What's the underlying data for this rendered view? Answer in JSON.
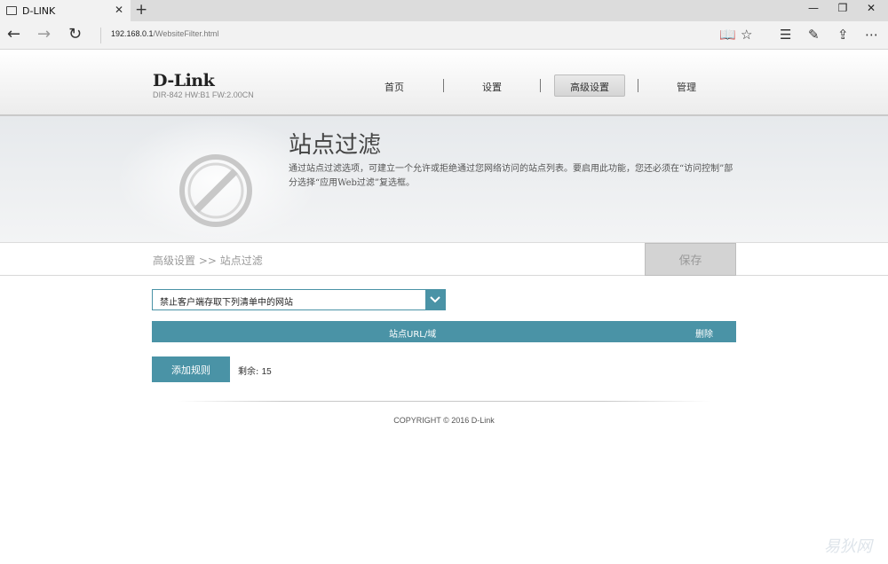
{
  "browser": {
    "tab_title": "D-LINK",
    "url_host": "192.168.0.1",
    "url_path": "/WebsiteFilter.html",
    "icons": [
      "favicon-icon",
      "close-icon",
      "plus-icon",
      "minimize-icon",
      "maximize-icon",
      "window-close-icon",
      "back-icon",
      "forward-icon",
      "refresh-icon",
      "reading-view-icon",
      "star-icon",
      "hub-icon",
      "web-note-icon",
      "share-icon",
      "more-icon"
    ]
  },
  "router": {
    "logo": "D-Link",
    "device_info": "DIR-842   HW:B1   FW:2.00CN",
    "menu": [
      {
        "label": "首页"
      },
      {
        "label": "设置"
      },
      {
        "label": "高级设置"
      },
      {
        "label": "管理"
      }
    ],
    "active_menu": "高级设置"
  },
  "banner": {
    "title": "站点过滤",
    "description": "通过站点过滤选项，可建立一个允许或拒绝通过您网络访问的站点列表。要启用此功能，您还必须在“访问控制”部分选择“应用Web过滤”复选框。",
    "icon": "no-entry-icon"
  },
  "breadcrumb": "高级设置 >> 站点过滤",
  "save_label": "保存",
  "filter_mode": {
    "selected": "禁止客户端存取下列清单中的网站"
  },
  "table": {
    "columns": [
      "站点URL/域",
      "删除"
    ],
    "rows": []
  },
  "add_rule_label": "添加规则",
  "remaining_label": "剩余:",
  "remaining_value": "15",
  "copyright": "COPYRIGHT © 2016 D-Link",
  "watermark": "易狄网",
  "colors": {
    "accent": "#4a93a6",
    "save_disabled_bg": "#d3d3d3"
  }
}
